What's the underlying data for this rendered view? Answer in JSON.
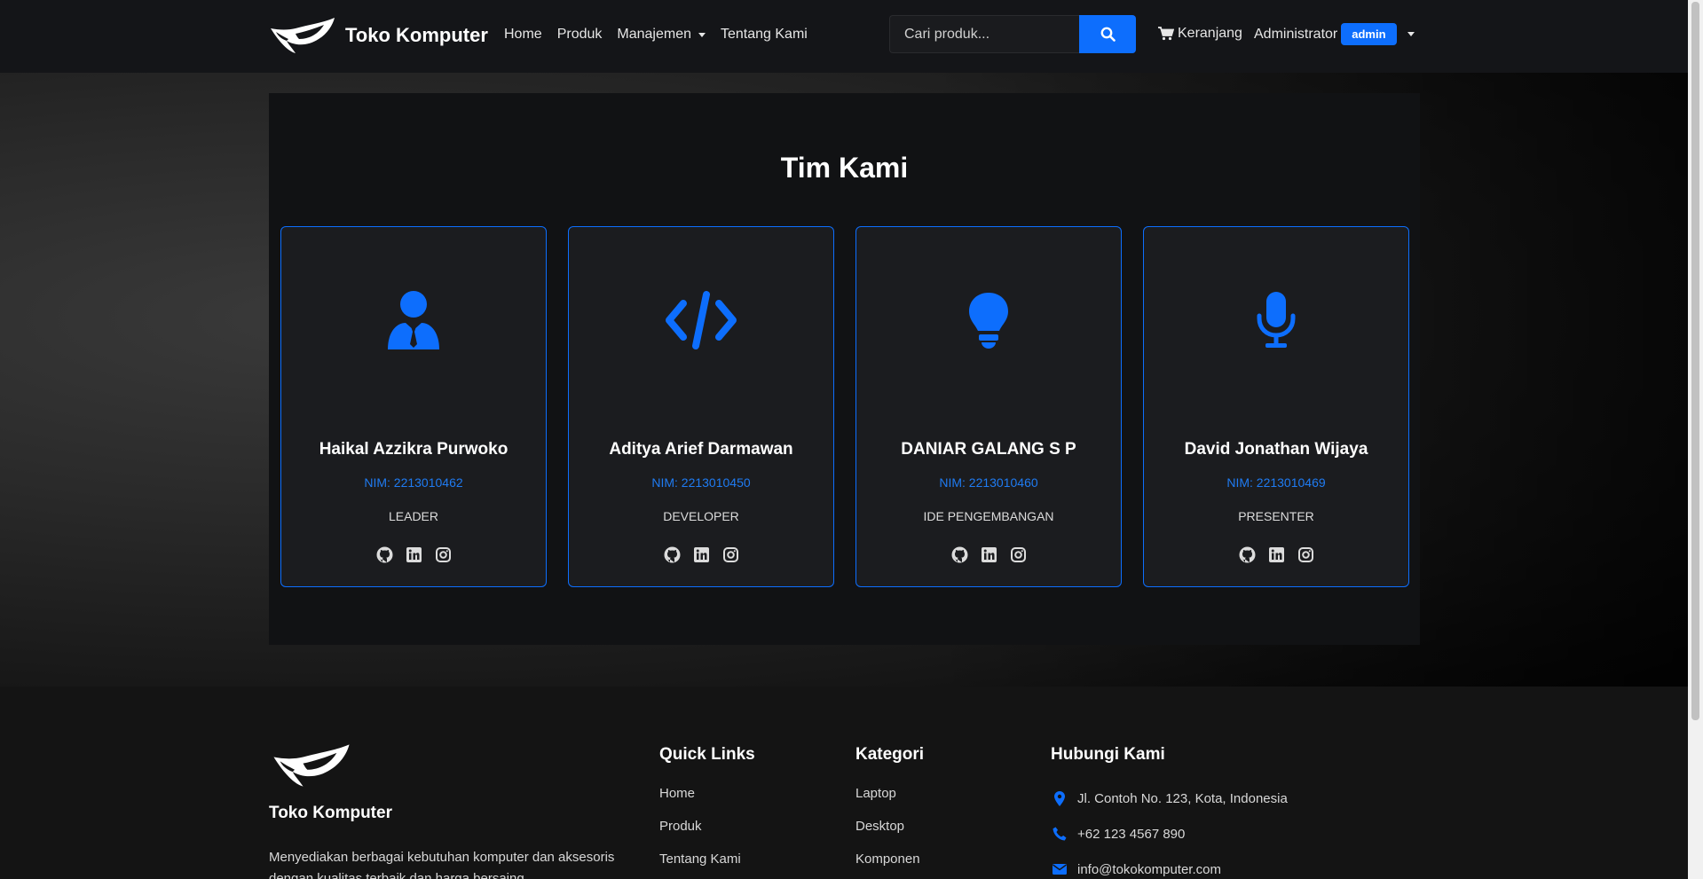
{
  "navbar": {
    "brand": "Toko Komputer",
    "links": [
      "Home",
      "Produk",
      "Manajemen",
      "Tentang Kami"
    ],
    "search_placeholder": "Cari produk...",
    "cart_label": "Keranjang",
    "user_name": "Administrator",
    "user_badge": "admin"
  },
  "team": {
    "title": "Tim Kami",
    "members": [
      {
        "name": "Haikal Azzikra Purwoko",
        "nim": "NIM: 2213010462",
        "role": "LEADER",
        "icon": "user-tie-icon"
      },
      {
        "name": "Aditya Arief Darmawan",
        "nim": "NIM: 2213010450",
        "role": "DEVELOPER",
        "icon": "code-icon"
      },
      {
        "name": "DANIAR GALANG S P",
        "nim": "NIM: 2213010460",
        "role": "IDE PENGEMBANGAN",
        "icon": "lightbulb-icon"
      },
      {
        "name": "David Jonathan Wijaya",
        "nim": "NIM: 2213010469",
        "role": "PRESENTER",
        "icon": "microphone-icon"
      }
    ],
    "social_icons": [
      "github-icon",
      "linkedin-icon",
      "instagram-icon"
    ]
  },
  "footer": {
    "brand": "Toko Komputer",
    "description": "Menyediakan berbagai kebutuhan komputer dan aksesoris dengan kualitas terbaik dan harga bersaing.",
    "quick_links": {
      "title": "Quick Links",
      "items": [
        "Home",
        "Produk",
        "Tentang Kami"
      ]
    },
    "categories": {
      "title": "Kategori",
      "items": [
        "Laptop",
        "Desktop",
        "Komponen"
      ]
    },
    "contact": {
      "title": "Hubungi Kami",
      "address": "Jl. Contoh No. 123, Kota, Indonesia",
      "phone": "+62 123 4567 890",
      "email": "info@tokokomputer.com"
    }
  },
  "colors": {
    "accent": "#0d6efd",
    "nim_text": "#1f7bf2",
    "background": "#141414"
  }
}
